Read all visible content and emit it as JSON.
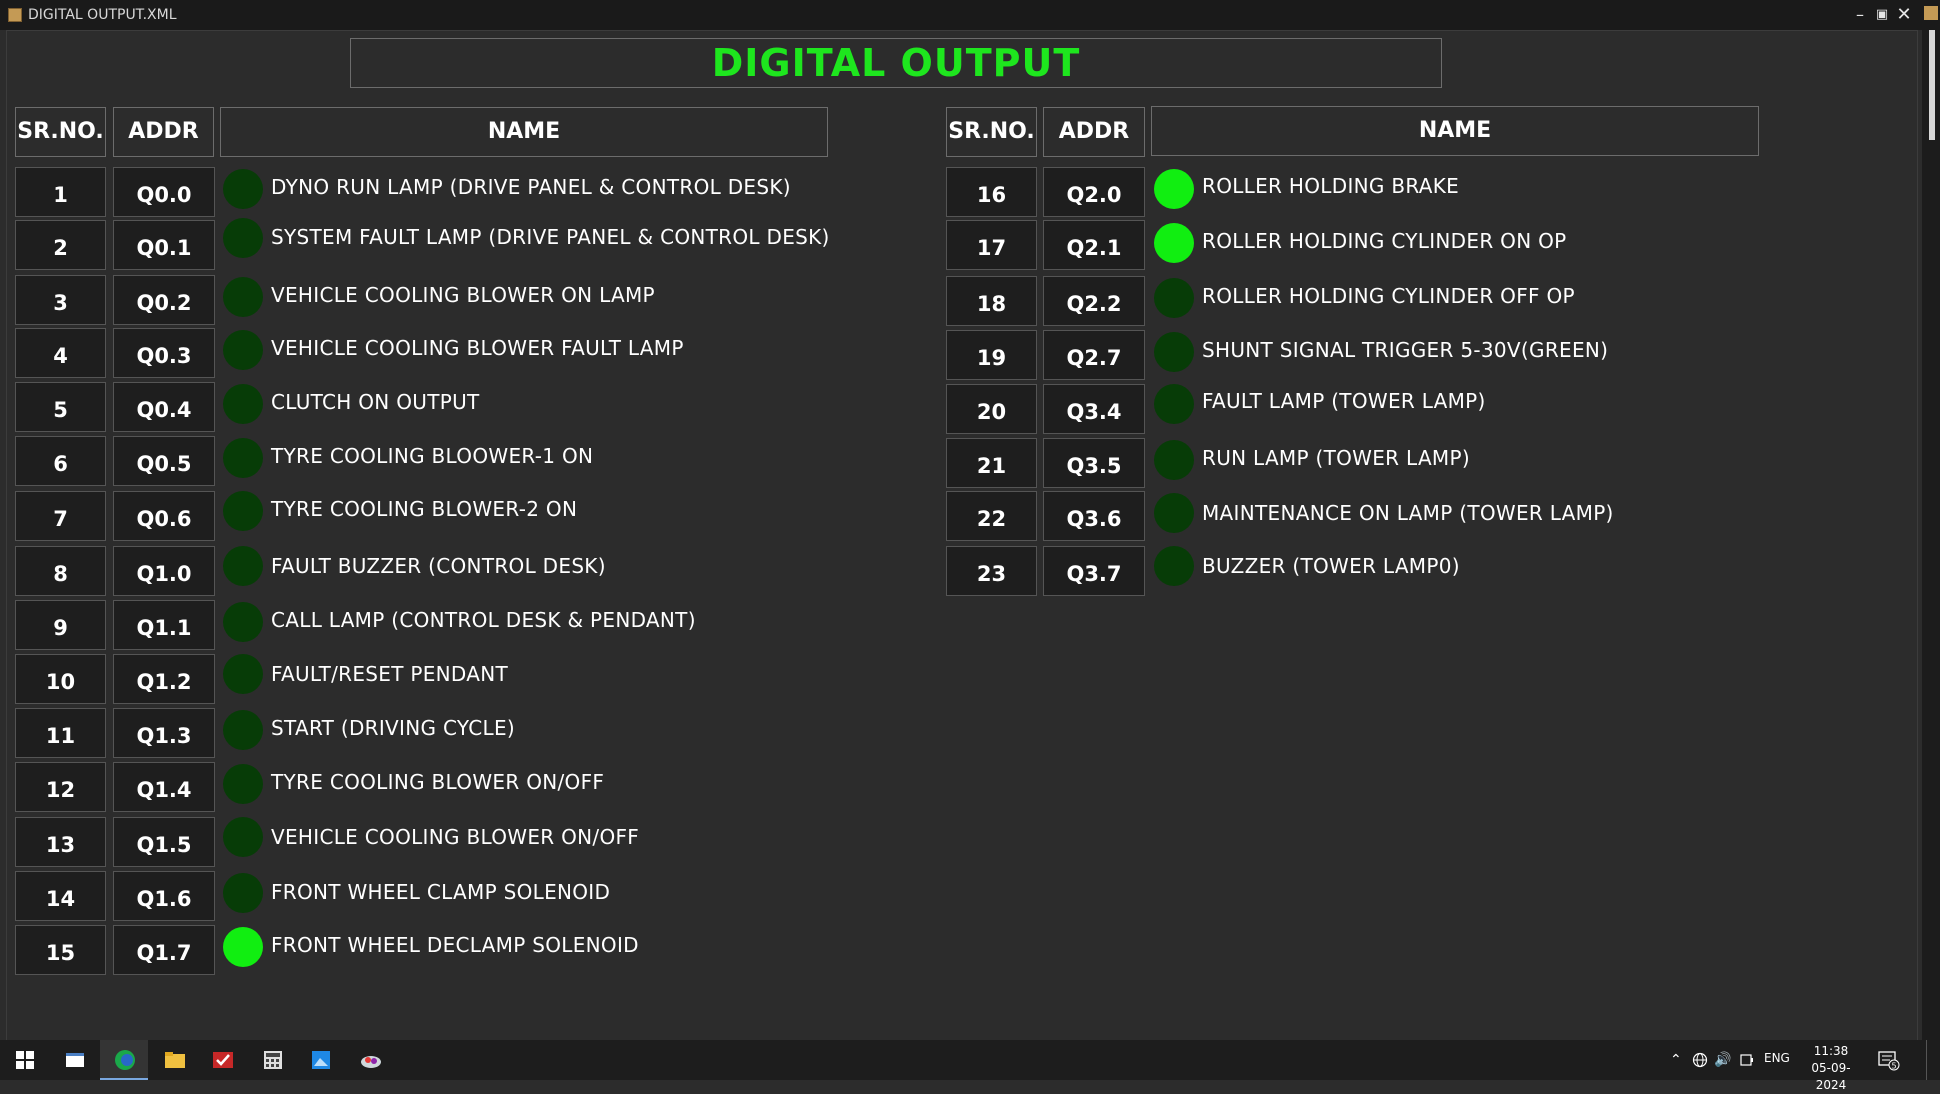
{
  "window": {
    "title": "DIGITAL OUTPUT.XML"
  },
  "page_title": "DIGITAL OUTPUT",
  "headers": {
    "srno": "SR.NO.",
    "addr": "ADDR",
    "name": "NAME"
  },
  "colors": {
    "lamp_on": "#11ee11",
    "lamp_off": "#073c07",
    "title": "#1ee61e"
  },
  "left_rows": [
    {
      "sr": "1",
      "addr": "Q0.0",
      "name": "DYNO RUN LAMP (DRIVE PANEL & CONTROL DESK)",
      "on": false
    },
    {
      "sr": "2",
      "addr": "Q0.1",
      "name": "SYSTEM FAULT LAMP (DRIVE PANEL & CONTROL DESK)",
      "on": false
    },
    {
      "sr": "3",
      "addr": "Q0.2",
      "name": "VEHICLE COOLING BLOWER ON LAMP",
      "on": false
    },
    {
      "sr": "4",
      "addr": "Q0.3",
      "name": "VEHICLE COOLING BLOWER FAULT LAMP",
      "on": false
    },
    {
      "sr": "5",
      "addr": "Q0.4",
      "name": "CLUTCH ON OUTPUT",
      "on": false
    },
    {
      "sr": "6",
      "addr": "Q0.5",
      "name": "TYRE COOLING BLOOWER-1 ON",
      "on": false
    },
    {
      "sr": "7",
      "addr": "Q0.6",
      "name": "TYRE COOLING BLOWER-2 ON",
      "on": false
    },
    {
      "sr": "8",
      "addr": "Q1.0",
      "name": "FAULT BUZZER (CONTROL DESK)",
      "on": false
    },
    {
      "sr": "9",
      "addr": "Q1.1",
      "name": "CALL LAMP (CONTROL DESK & PENDANT)",
      "on": false
    },
    {
      "sr": "10",
      "addr": "Q1.2",
      "name": "FAULT/RESET PENDANT",
      "on": false
    },
    {
      "sr": "11",
      "addr": "Q1.3",
      "name": "START (DRIVING CYCLE)",
      "on": false
    },
    {
      "sr": "12",
      "addr": "Q1.4",
      "name": "TYRE COOLING BLOWER ON/OFF",
      "on": false
    },
    {
      "sr": "13",
      "addr": "Q1.5",
      "name": "VEHICLE COOLING BLOWER ON/OFF",
      "on": false
    },
    {
      "sr": "14",
      "addr": "Q1.6",
      "name": "FRONT WHEEL CLAMP SOLENOID",
      "on": false
    },
    {
      "sr": "15",
      "addr": "Q1.7",
      "name": "FRONT WHEEL DECLAMP SOLENOID",
      "on": true
    }
  ],
  "right_rows": [
    {
      "sr": "16",
      "addr": "Q2.0",
      "name": "ROLLER HOLDING BRAKE",
      "on": true
    },
    {
      "sr": "17",
      "addr": "Q2.1",
      "name": "ROLLER HOLDING CYLINDER ON OP",
      "on": true
    },
    {
      "sr": "18",
      "addr": "Q2.2",
      "name": "ROLLER HOLDING CYLINDER OFF OP",
      "on": false
    },
    {
      "sr": "19",
      "addr": "Q2.7",
      "name": "SHUNT SIGNAL TRIGGER 5-30V(GREEN)",
      "on": false
    },
    {
      "sr": "20",
      "addr": "Q3.4",
      "name": "FAULT LAMP (TOWER LAMP)",
      "on": false
    },
    {
      "sr": "21",
      "addr": "Q3.5",
      "name": "RUN LAMP (TOWER LAMP)",
      "on": false
    },
    {
      "sr": "22",
      "addr": "Q3.6",
      "name": "MAINTENANCE ON LAMP (TOWER LAMP)",
      "on": false
    },
    {
      "sr": "23",
      "addr": "Q3.7",
      "name": "BUZZER (TOWER LAMP0)",
      "on": false
    }
  ],
  "taskbar": {
    "language": "ENG",
    "time": "11:38",
    "date": "05-09-2024",
    "notification_count": "5"
  }
}
